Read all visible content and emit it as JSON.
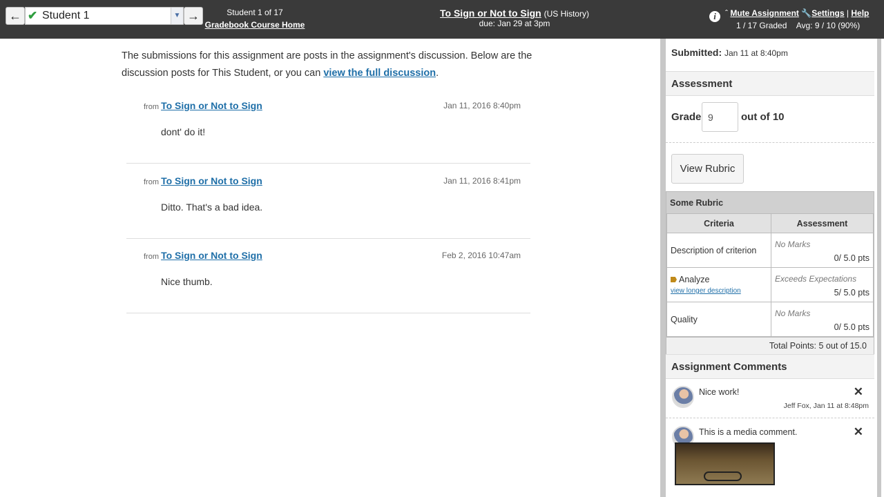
{
  "header": {
    "student_selected": "Student 1",
    "student_count": "Student 1 of 17",
    "gradebook_link": "Gradebook Course Home",
    "assignment_title": "To Sign or Not to Sign",
    "course_name": "(US History)",
    "due_date": "due: Jan 29 at 3pm",
    "mute_assignment": "Mute Assignment",
    "settings": "Settings",
    "separator": "|",
    "help": "Help",
    "graded_count": "1 / 17 Graded",
    "average": "Avg: 9 / 10 (90%)",
    "icons": [
      "arrow-left-icon",
      "checkmark-icon",
      "chevron-down-icon",
      "arrow-right-icon",
      "info-icon",
      "caret-up-icon",
      "wrench-icon"
    ]
  },
  "main": {
    "intro_text": "The submissions for this assignment are posts in the assignment's discussion. Below are the discussion posts for This Student, or you can",
    "intro_link": "view the full discussion",
    "intro_end": ".",
    "posts": [
      {
        "from_label": "from",
        "topic": "To Sign or Not to Sign",
        "date": "Jan 11, 2016 8:40pm",
        "body": "dont' do it!"
      },
      {
        "from_label": "from",
        "topic": "To Sign or Not to Sign",
        "date": "Jan 11, 2016 8:41pm",
        "body": "Ditto. That's a bad idea."
      },
      {
        "from_label": "from",
        "topic": "To Sign or Not to Sign",
        "date": "Feb 2, 2016 10:47am",
        "body": "Nice thumb."
      }
    ]
  },
  "panel": {
    "submitted_label": "Submitted:",
    "submitted_value": "Jan 11 at 8:40pm",
    "assessment_heading": "Assessment",
    "grade_label": "Grade",
    "grade_value": "9",
    "grade_out_of": "out of 10",
    "view_rubric": "View Rubric",
    "rubric": {
      "title": "Some Rubric",
      "col_criteria": "Criteria",
      "col_assessment": "Assessment",
      "rows": [
        {
          "criterion": "Description of criterion",
          "rating": "No Marks",
          "points": "0/ 5.0 pts"
        },
        {
          "criterion": "Analyze",
          "link": "view longer description",
          "rating": "Exceeds Expectations",
          "points": "5/ 5.0 pts"
        },
        {
          "criterion": "Quality",
          "rating": "No Marks",
          "points": "0/ 5.0 pts"
        }
      ],
      "total": "Total Points: 5 out of 15.0"
    },
    "comments_heading": "Assignment Comments",
    "comments": [
      {
        "text": "Nice work!",
        "meta": "Jeff Fox, Jan 11 at 8:48pm"
      },
      {
        "text": "This is a media comment.",
        "meta": ""
      }
    ]
  }
}
